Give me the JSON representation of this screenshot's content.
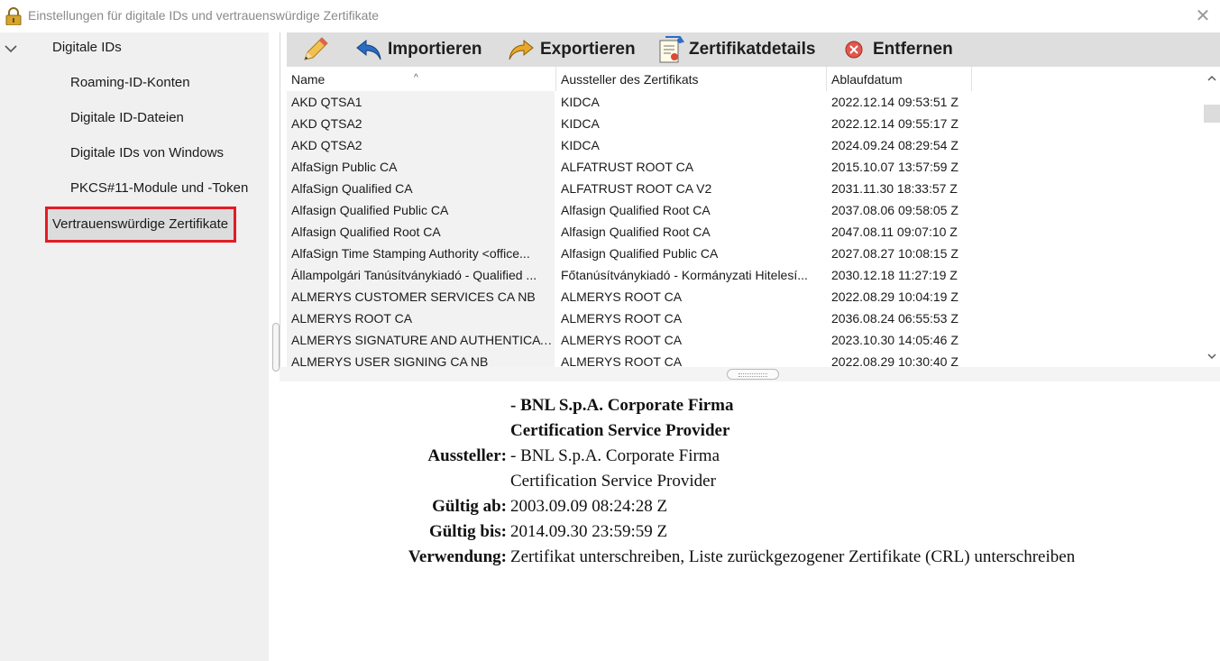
{
  "window": {
    "title": "Einstellungen für digitale IDs und vertrauenswürdige Zertifikate",
    "close_glyph": "✕",
    "title_icon": "lock-icon"
  },
  "sidebar": {
    "group_label": "Digitale IDs",
    "items": [
      {
        "label": "Roaming-ID-Konten"
      },
      {
        "label": "Digitale ID-Dateien"
      },
      {
        "label": "Digitale IDs von Windows"
      },
      {
        "label": "PKCS#11-Module und -Token"
      }
    ],
    "selected_label": "Vertrauenswürdige Zertifikate",
    "highlight_color": "#e31b23"
  },
  "toolbar": {
    "edit_icon": "pencil-icon",
    "import_label": "Importieren",
    "export_label": "Exportieren",
    "details_label": "Zertifikatdetails",
    "remove_label": "Entfernen"
  },
  "table": {
    "headers": [
      "Name",
      "Aussteller des Zertifikats",
      "Ablaufdatum"
    ],
    "sort_indicator": "^",
    "rows": [
      [
        "AKD QTSA1",
        "KIDCA",
        "2022.12.14 09:53:51 Z"
      ],
      [
        "AKD QTSA2",
        "KIDCA",
        "2022.12.14 09:55:17 Z"
      ],
      [
        "AKD QTSA2",
        "KIDCA",
        "2024.09.24 08:29:54 Z"
      ],
      [
        "AlfaSign Public CA",
        "ALFATRUST ROOT CA",
        "2015.10.07 13:57:59 Z"
      ],
      [
        "AlfaSign Qualified CA",
        "ALFATRUST ROOT CA V2",
        "2031.11.30 18:33:57 Z"
      ],
      [
        "Alfasign Qualified Public CA",
        "Alfasign Qualified Root CA",
        "2037.08.06 09:58:05 Z"
      ],
      [
        "Alfasign Qualified Root CA",
        "Alfasign Qualified Root CA",
        "2047.08.11 09:07:10 Z"
      ],
      [
        "AlfaSign Time Stamping Authority <office...",
        "Alfasign Qualified Public CA",
        "2027.08.27 10:08:15 Z"
      ],
      [
        "Állampolgári Tanúsítványkiadó - Qualified ...",
        "Főtanúsítványkiadó - Kormányzati Hitelesí...",
        "2030.12.18 11:27:19 Z"
      ],
      [
        "ALMERYS CUSTOMER SERVICES CA NB",
        "ALMERYS ROOT CA",
        "2022.08.29 10:04:19 Z"
      ],
      [
        "ALMERYS ROOT CA",
        "ALMERYS ROOT CA",
        "2036.08.24 06:55:53 Z"
      ],
      [
        "ALMERYS SIGNATURE AND AUTHENTICAT...",
        "ALMERYS ROOT CA",
        "2023.10.30 14:05:46 Z"
      ],
      [
        "ALMERYS USER SIGNING CA NB",
        "ALMERYS ROOT CA",
        "2022.08.29 10:30:40 Z"
      ]
    ]
  },
  "details": {
    "subject_line1": "- BNL S.p.A. Corporate Firma",
    "subject_line2": "Certification Service Provider",
    "issuer_label": "Aussteller:",
    "issuer_line1": "- BNL S.p.A. Corporate Firma",
    "issuer_line2": "Certification Service Provider",
    "valid_from_label": "Gültig ab:",
    "valid_from": "2003.09.09 08:24:28 Z",
    "valid_to_label": "Gültig bis:",
    "valid_to": "2014.09.30 23:59:59 Z",
    "usage_label": "Verwendung:",
    "usage": "Zertifikat unterschreiben, Liste zurückgezogener Zertifikate (CRL) unterschreiben"
  }
}
